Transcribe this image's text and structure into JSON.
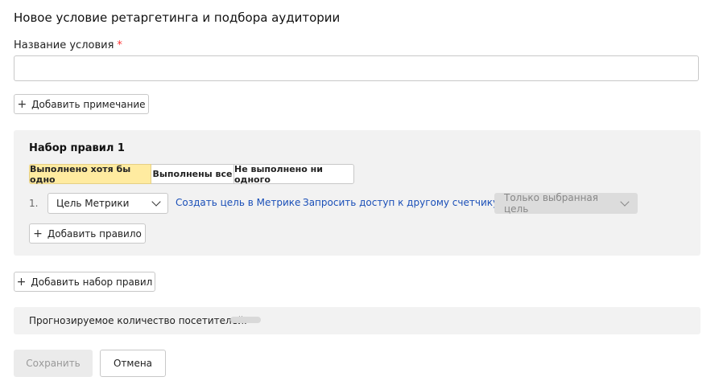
{
  "page": {
    "title": "Новое условие ретаргетинга и подбора аудитории",
    "name_label": "Название условия",
    "required_mark": "*",
    "name_value": "",
    "add_note_label": "Добавить примечание"
  },
  "rule_set": {
    "title": "Набор правил 1",
    "modes": [
      {
        "label": "Выполнено хотя бы одно",
        "selected": true
      },
      {
        "label": "Выполнены все",
        "selected": false
      },
      {
        "label": "Не выполнено ни одного",
        "selected": false
      }
    ],
    "rule": {
      "number": "1.",
      "type_value": "Цель Метрики",
      "create_goal_link": "Создать цель в Метрике",
      "request_access_link": "Запросить доступ к другому счетчику",
      "scope_value": "Только выбранная цель"
    },
    "add_rule_label": "Добавить правило"
  },
  "add_set_label": "Добавить набор правил",
  "forecast": {
    "label": "Прогнозируемое количество посетителей:"
  },
  "footer": {
    "save_label": "Сохранить",
    "cancel_label": "Отмена"
  },
  "colors": {
    "accent_selected": "#ffeba0",
    "link": "#1a4fb8",
    "required": "#ff3333",
    "panel_bg": "#f2f2f2"
  },
  "icons": {
    "plus": "plus-icon",
    "chevron": "chevron-down-icon"
  }
}
